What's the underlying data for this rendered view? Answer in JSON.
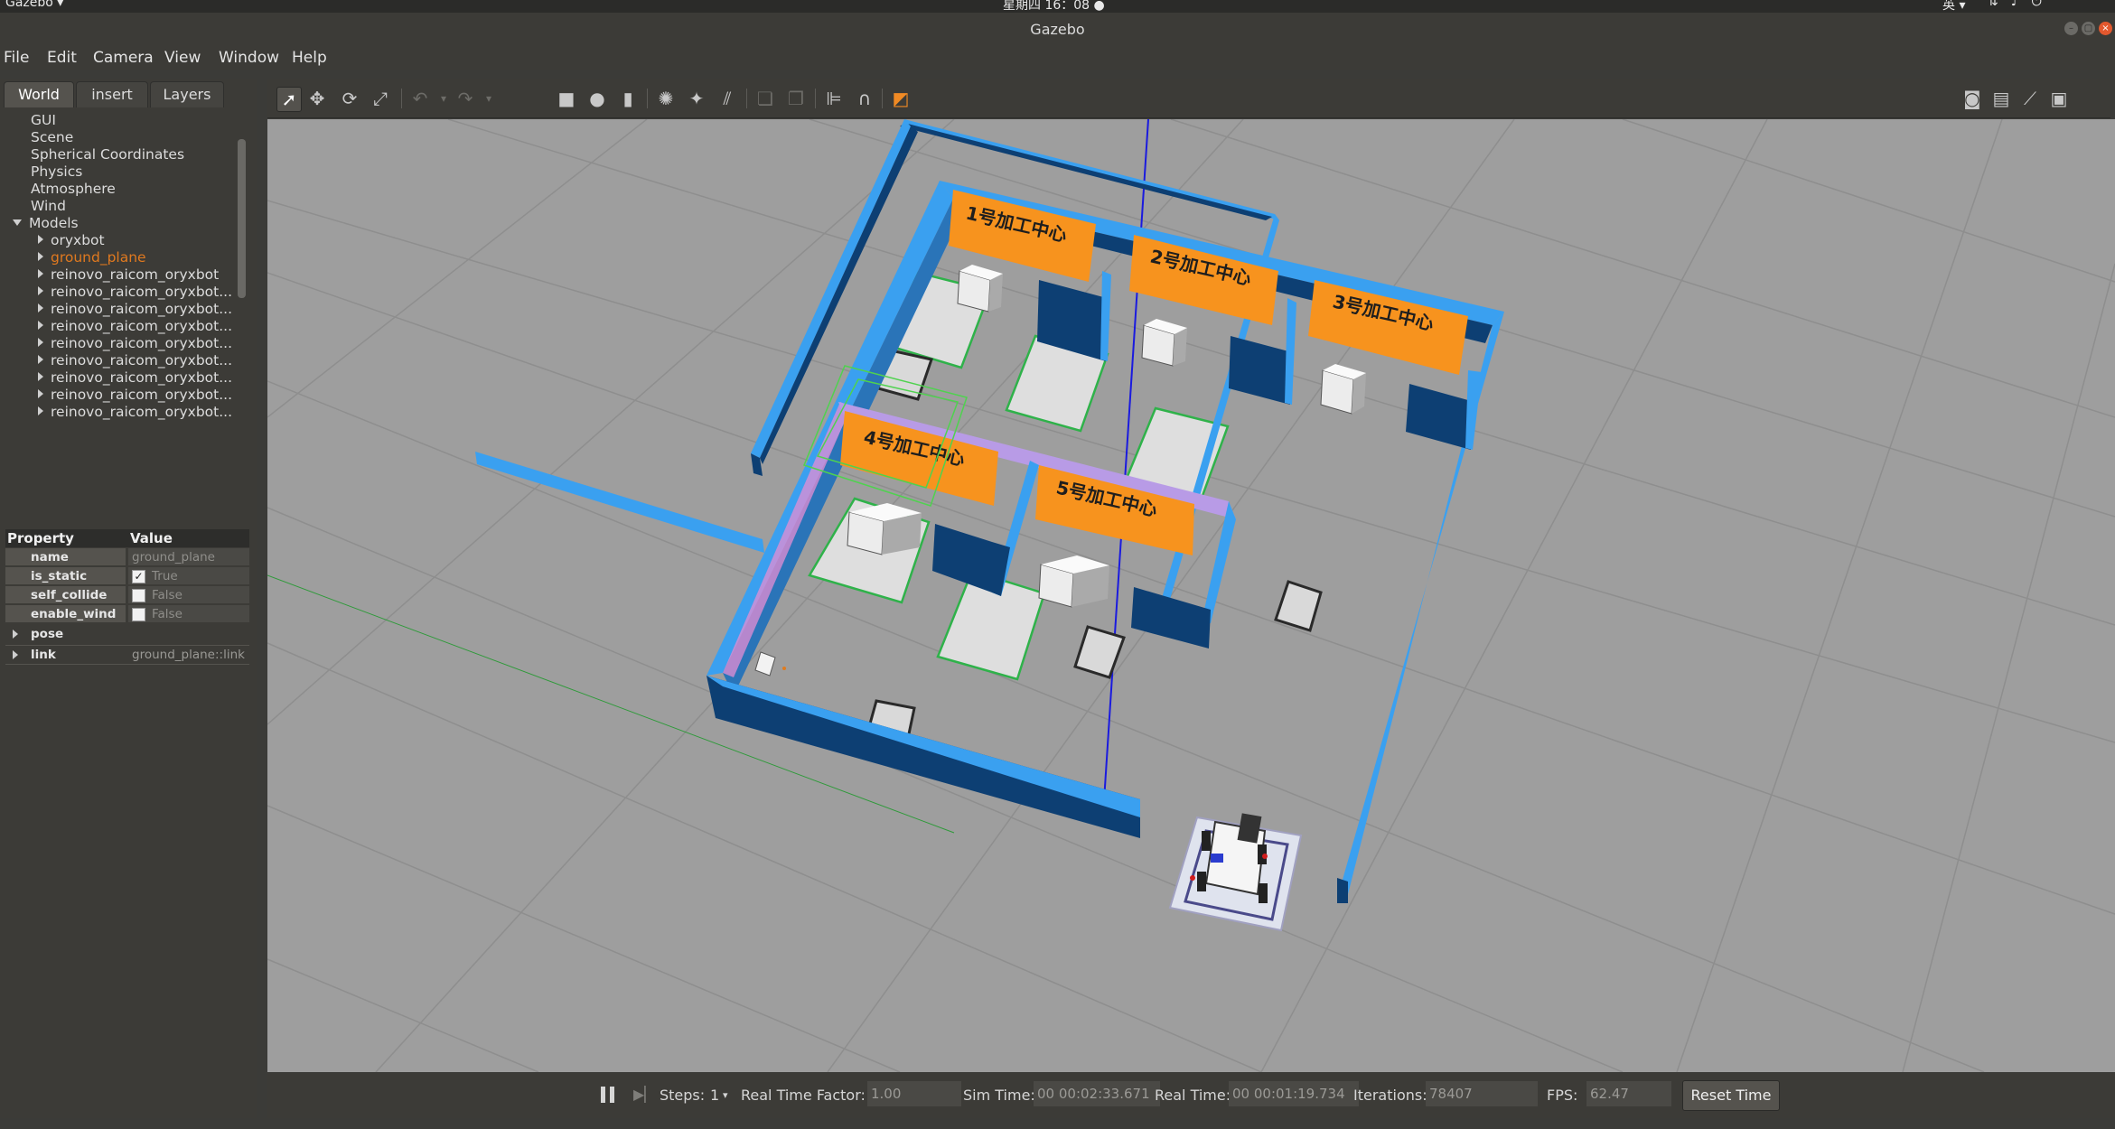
{
  "system_bar": {
    "app_menu": "Gazebo ▾",
    "clock": "星期四 16：08 ●",
    "input_method": "英 ▾",
    "tray_icons": [
      "network-icon",
      "volume-icon",
      "power-icon"
    ]
  },
  "window": {
    "title": "Gazebo"
  },
  "menu": [
    "File",
    "Edit",
    "Camera",
    "View",
    "Window",
    "Help"
  ],
  "left_panel": {
    "tabs": [
      "World",
      "insert",
      "Layers"
    ],
    "active_tab": "World",
    "tree": {
      "top_items": [
        "GUI",
        "Scene",
        "Spherical Coordinates",
        "Physics",
        "Atmosphere",
        "Wind"
      ],
      "models_label": "Models",
      "models": [
        "oryxbot",
        "ground_plane",
        "reinovo_raicom_oryxbot",
        "reinovo_raicom_oryxbot...",
        "reinovo_raicom_oryxbot...",
        "reinovo_raicom_oryxbot...",
        "reinovo_raicom_oryxbot...",
        "reinovo_raicom_oryxbot...",
        "reinovo_raicom_oryxbot...",
        "reinovo_raicom_oryxbot...",
        "reinovo_raicom_oryxbot..."
      ],
      "selected_model": "ground_plane"
    },
    "properties": {
      "header": {
        "property": "Property",
        "value": "Value"
      },
      "rows": [
        {
          "name": "name",
          "value": "ground_plane"
        },
        {
          "name": "is_static",
          "value": "True",
          "checked": true
        },
        {
          "name": "self_collide",
          "value": "False",
          "checked": false
        },
        {
          "name": "enable_wind",
          "value": "False",
          "checked": false
        }
      ],
      "groups": [
        {
          "name": "pose",
          "value": ""
        },
        {
          "name": "link",
          "value": "ground_plane::link"
        }
      ]
    }
  },
  "toolbar": {
    "left_tools": [
      "select-arrow-icon",
      "translate-icon",
      "rotate-icon",
      "scale-icon",
      "undo-icon",
      "redo-icon",
      "box-icon",
      "sphere-icon",
      "cylinder-icon",
      "point-light-icon",
      "spot-light-icon",
      "directional-light-icon",
      "copy-icon",
      "paste-icon",
      "align-icon",
      "snap-icon",
      "view-angle-icon"
    ],
    "right_tools": [
      "screenshot-icon",
      "log-icon",
      "plot-icon",
      "record-icon"
    ]
  },
  "scene": {
    "station_labels": [
      "1号加工中心",
      "2号加工中心",
      "3号加工中心",
      "4号加工中心",
      "5号加工中心"
    ],
    "colors": {
      "ground": "#9e9e9e",
      "wall_top": "#3aa0f0",
      "wall_side": "#0d3f73",
      "label_bg": "#f7931e",
      "pad_border": "#2fb24a"
    }
  },
  "bottom_bar": {
    "steps_label": "Steps:",
    "steps_value": "1",
    "rtf_label": "Real Time Factor:",
    "rtf_value": "1.00",
    "sim_time_label": "Sim Time:",
    "sim_time_value": "00 00:02:33.671",
    "real_time_label": "Real Time:",
    "real_time_value": "00 00:01:19.734",
    "iterations_label": "Iterations:",
    "iterations_value": "78407",
    "fps_label": "FPS:",
    "fps_value": "62.47",
    "reset_label": "Reset Time"
  }
}
